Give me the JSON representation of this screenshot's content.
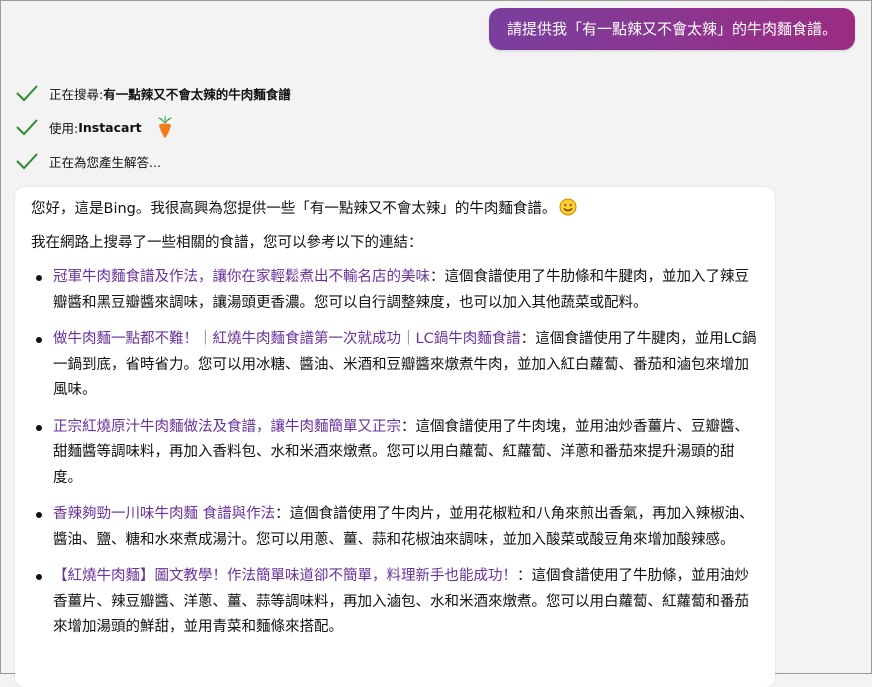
{
  "user_message": "請提供我「有一點辣又不會太辣」的牛肉麵食譜。",
  "status": [
    {
      "prefix": "正在搜尋: ",
      "bold": "有一點辣又不會太辣的牛肉麵食譜",
      "icon": "check-icon"
    },
    {
      "prefix": "使用: ",
      "bold": "Instacart",
      "icon": "check-icon",
      "extra_icon": "instacart-carrot-icon"
    },
    {
      "prefix": "正在為您產生解答...",
      "bold": "",
      "icon": "check-icon"
    }
  ],
  "answer": {
    "greeting": "您好，這是Bing。我很高興為您提供一些「有一點辣又不會太辣」的牛肉麵食譜。",
    "intro": "我在網路上搜尋了一些相關的食譜，您可以參考以下的連結：",
    "links": [
      {
        "title": "冠軍牛肉麵食譜及作法，讓你在家輕鬆煮出不輸名店的美味",
        "desc": "：這個食譜使用了牛肋條和牛腱肉，並加入了辣豆瓣醬和黑豆瓣醬來調味，讓湯頭更香濃。您可以自行調整辣度，也可以加入其他蔬菜或配料。"
      },
      {
        "title": "做牛肉麵一點都不難！｜紅燒牛肉麵食譜第一次就成功｜LC鍋牛肉麵食譜",
        "desc": "：這個食譜使用了牛腱肉，並用LC鍋一鍋到底，省時省力。您可以用冰糖、醬油、米酒和豆瓣醬來燉煮牛肉，並加入紅白蘿蔔、番茄和滷包來增加風味。"
      },
      {
        "title": "正宗紅燒原汁牛肉麵做法及食譜，讓牛肉麵簡單又正宗",
        "desc": "：這個食譜使用了牛肉塊，並用油炒香薑片、豆瓣醬、甜麵醬等調味料，再加入香料包、水和米酒來燉煮。您可以用白蘿蔔、紅蘿蔔、洋蔥和番茄來提升湯頭的甜度。"
      },
      {
        "title": "香辣夠勁一川味牛肉麵 食譜與作法",
        "desc": "：這個食譜使用了牛肉片，並用花椒粒和八角來煎出香氣，再加入辣椒油、醬油、鹽、糖和水來煮成湯汁。您可以用蔥、薑、蒜和花椒油來調味，並加入酸菜或酸豆角來增加酸辣感。"
      },
      {
        "title": "【紅燒牛肉麵】圖文教學！作法簡單味道卻不簡單，料理新手也能成功！",
        "desc": "：這個食譜使用了牛肋條，並用油炒香薑片、辣豆瓣醬、洋蔥、薑、蒜等調味料，再加入滷包、水和米酒來燉煮。您可以用白蘿蔔、紅蘿蔔和番茄來增加湯頭的鮮甜，並用青菜和麵條來搭配。"
      }
    ]
  },
  "colors": {
    "user_bubble_start": "#7a3f9e",
    "user_bubble_end": "#9b2c82",
    "check": "#2e8b2e",
    "link": "#6a3399",
    "background": "#f3f3f3",
    "card": "#ffffff"
  }
}
